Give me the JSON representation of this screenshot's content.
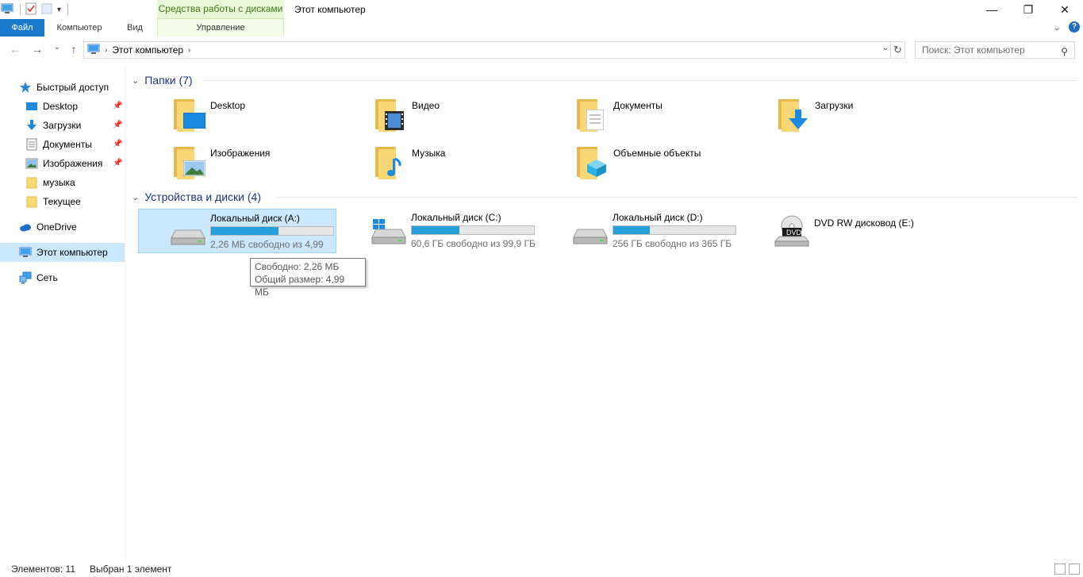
{
  "window": {
    "title": "Этот компьютер",
    "context_tab": "Средства работы с дисками",
    "minimize": "—",
    "maximize": "❐",
    "close": "✕"
  },
  "ribbon": {
    "tabs": [
      "Файл",
      "Компьютер",
      "Вид"
    ],
    "context_subtab": "Управление",
    "help": "?"
  },
  "nav": {
    "back": "←",
    "forward": "→",
    "recent": "⌄",
    "up": "↑",
    "path": [
      "Этот компьютер"
    ],
    "refresh": "↻",
    "search_placeholder": "Поиск: Этот компьютер"
  },
  "sidebar": {
    "quick_access": "Быстрый доступ",
    "quick_items": [
      {
        "label": "Desktop",
        "icon": "desktop-icon",
        "pinned": true
      },
      {
        "label": "Загрузки",
        "icon": "downloads-icon",
        "pinned": true
      },
      {
        "label": "Документы",
        "icon": "documents-icon",
        "pinned": true
      },
      {
        "label": "Изображения",
        "icon": "pictures-icon",
        "pinned": true
      },
      {
        "label": "музыка",
        "icon": "folder-icon",
        "pinned": false
      },
      {
        "label": "Текущее",
        "icon": "folder-icon",
        "pinned": false
      }
    ],
    "onedrive": "OneDrive",
    "this_pc": "Этот компьютер",
    "network": "Сеть"
  },
  "folders_group": {
    "title": "Папки (7)",
    "items": [
      {
        "label": "Desktop",
        "icon": "desktop-folder-icon"
      },
      {
        "label": "Видео",
        "icon": "videos-folder-icon"
      },
      {
        "label": "Документы",
        "icon": "documents-folder-icon"
      },
      {
        "label": "Загрузки",
        "icon": "downloads-folder-icon"
      },
      {
        "label": "Изображения",
        "icon": "pictures-folder-icon"
      },
      {
        "label": "Музыка",
        "icon": "music-folder-icon"
      },
      {
        "label": "Объемные объекты",
        "icon": "3d-objects-folder-icon"
      }
    ]
  },
  "drives_group": {
    "title": "Устройства и диски (4)",
    "items": [
      {
        "label": "Локальный диск (A:)",
        "free": "2,26 МБ свободно из 4,99",
        "used_fraction": 0.55,
        "selected": true
      },
      {
        "label": "Локальный диск (C:)",
        "free": "60,6 ГБ свободно из 99,9 ГБ",
        "used_fraction": 0.39,
        "selected": false
      },
      {
        "label": "Локальный диск (D:)",
        "free": "256 ГБ свободно из 365 ГБ",
        "used_fraction": 0.3,
        "selected": false
      },
      {
        "label": "DVD RW дисковод (E:)",
        "free": "",
        "used_fraction": null,
        "selected": false
      }
    ],
    "dvd_badge": "DVD"
  },
  "tooltip": {
    "line1": "Свободно: 2,26 МБ",
    "line2": "Общий размер: 4,99 МБ"
  },
  "status": {
    "count": "Элементов: 11",
    "selected": "Выбран 1 элемент"
  },
  "colors": {
    "accent": "#1979ca",
    "selection": "#cce8ff",
    "progress": "#26a0da",
    "group_header": "#1e3287",
    "context_tab": "#e9f6d7"
  }
}
